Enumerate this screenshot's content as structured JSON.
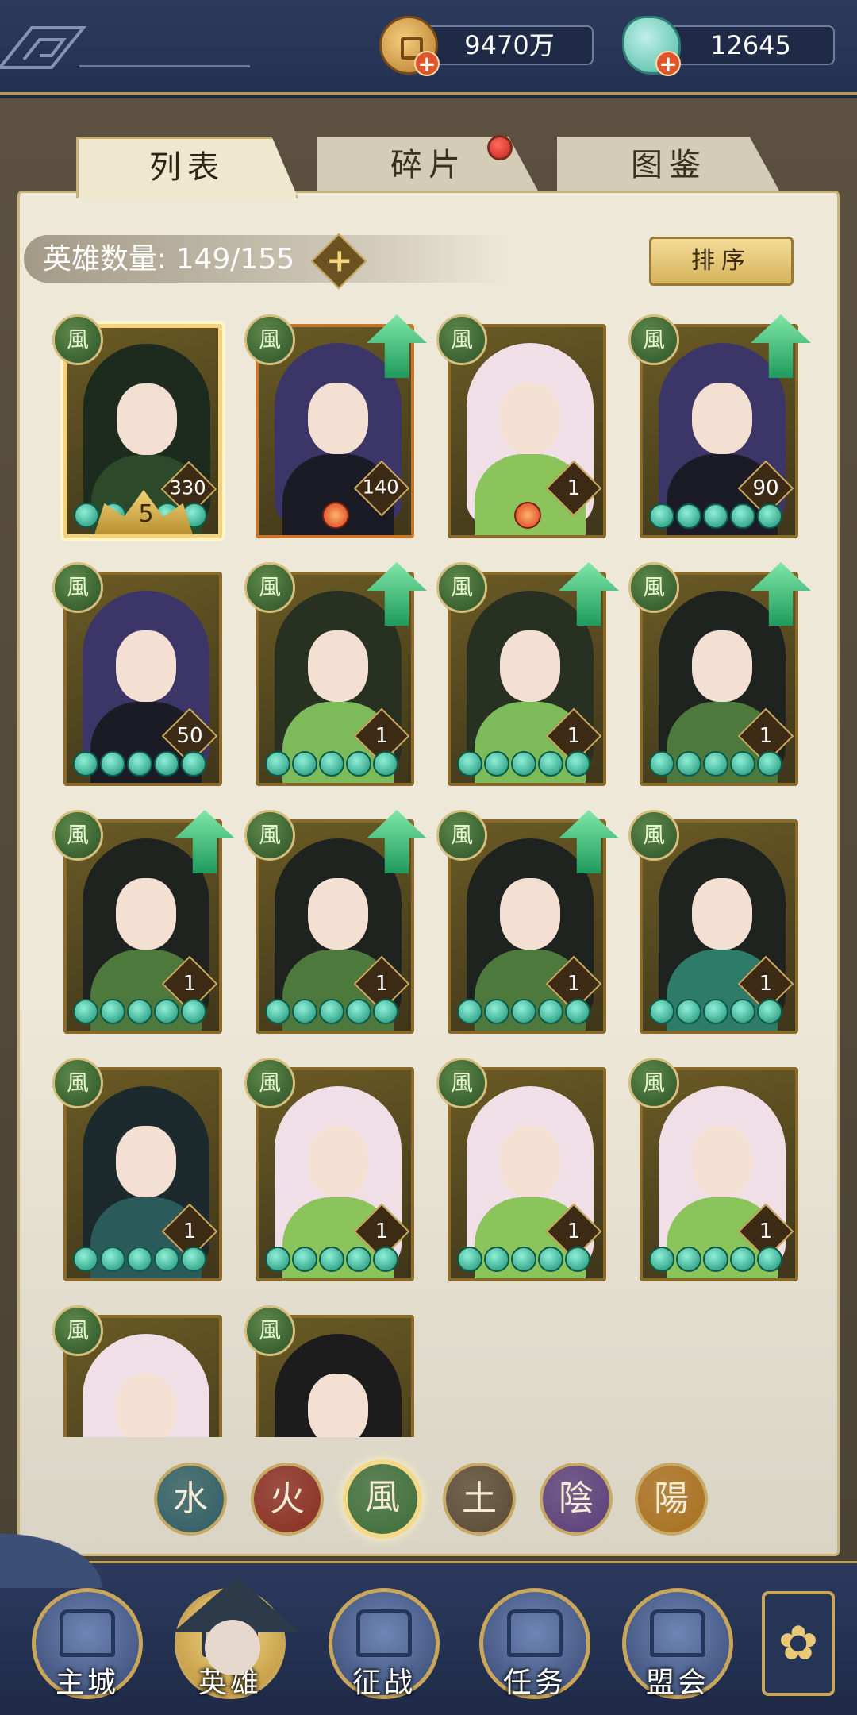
{
  "resources": {
    "coins": "9470万",
    "jade": "12645",
    "coin_plus": "+",
    "jade_plus": "+"
  },
  "tabs": [
    {
      "label": "列表",
      "active": true
    },
    {
      "label": "碎片",
      "active": false
    },
    {
      "label": "图鉴",
      "active": false
    }
  ],
  "hero_count": "英雄数量: 149/155",
  "add_label": "+",
  "sort_label": "排序",
  "element_badge_glyph": "風",
  "heroes": [
    {
      "level": "330",
      "stars": 5,
      "highlighted": true,
      "upgradable": false
    },
    {
      "level": "140",
      "stars": 0,
      "highlighted": false,
      "upgradable": true
    },
    {
      "level": "1",
      "stars": 0,
      "highlighted": false,
      "upgradable": false
    },
    {
      "level": "90",
      "stars": 5,
      "highlighted": false,
      "upgradable": true
    },
    {
      "level": "50",
      "stars": 5,
      "highlighted": false,
      "upgradable": false
    },
    {
      "level": "1",
      "stars": 5,
      "highlighted": false,
      "upgradable": true
    },
    {
      "level": "1",
      "stars": 5,
      "highlighted": false,
      "upgradable": true
    },
    {
      "level": "1",
      "stars": 5,
      "highlighted": false,
      "upgradable": true
    },
    {
      "level": "1",
      "stars": 5,
      "highlighted": false,
      "upgradable": true
    },
    {
      "level": "1",
      "stars": 5,
      "highlighted": false,
      "upgradable": true
    },
    {
      "level": "1",
      "stars": 5,
      "highlighted": false,
      "upgradable": true
    },
    {
      "level": "1",
      "stars": 5,
      "highlighted": false,
      "upgradable": false
    },
    {
      "level": "1",
      "stars": 5,
      "highlighted": false,
      "upgradable": false
    },
    {
      "level": "1",
      "stars": 5,
      "highlighted": false,
      "upgradable": false
    },
    {
      "level": "1",
      "stars": 5,
      "highlighted": false,
      "upgradable": false
    },
    {
      "level": "1",
      "stars": 5,
      "highlighted": false,
      "upgradable": false
    },
    {
      "level": "",
      "stars": 0,
      "highlighted": false,
      "upgradable": false
    },
    {
      "level": "",
      "stars": 0,
      "highlighted": false,
      "upgradable": false
    }
  ],
  "top_card_crown": "5",
  "elements": [
    {
      "glyph": "水",
      "color": "#2f5e63",
      "selected": false
    },
    {
      "glyph": "火",
      "color": "#8a2e22",
      "selected": false
    },
    {
      "glyph": "風",
      "color": "#3f6e3a",
      "selected": true
    },
    {
      "glyph": "土",
      "color": "#5a4a35",
      "selected": false
    },
    {
      "glyph": "陰",
      "color": "#5b3f7a",
      "selected": false
    },
    {
      "glyph": "陽",
      "color": "#a9701e",
      "selected": false
    }
  ],
  "nav": [
    {
      "label": "主城",
      "icon": "castle-icon"
    },
    {
      "label": "英雄",
      "icon": "hero-icon"
    },
    {
      "label": "征战",
      "icon": "battle-icon"
    },
    {
      "label": "任务",
      "icon": "quest-icon"
    },
    {
      "label": "盟会",
      "icon": "guild-icon"
    }
  ],
  "more_icon": "menu-flower-icon"
}
